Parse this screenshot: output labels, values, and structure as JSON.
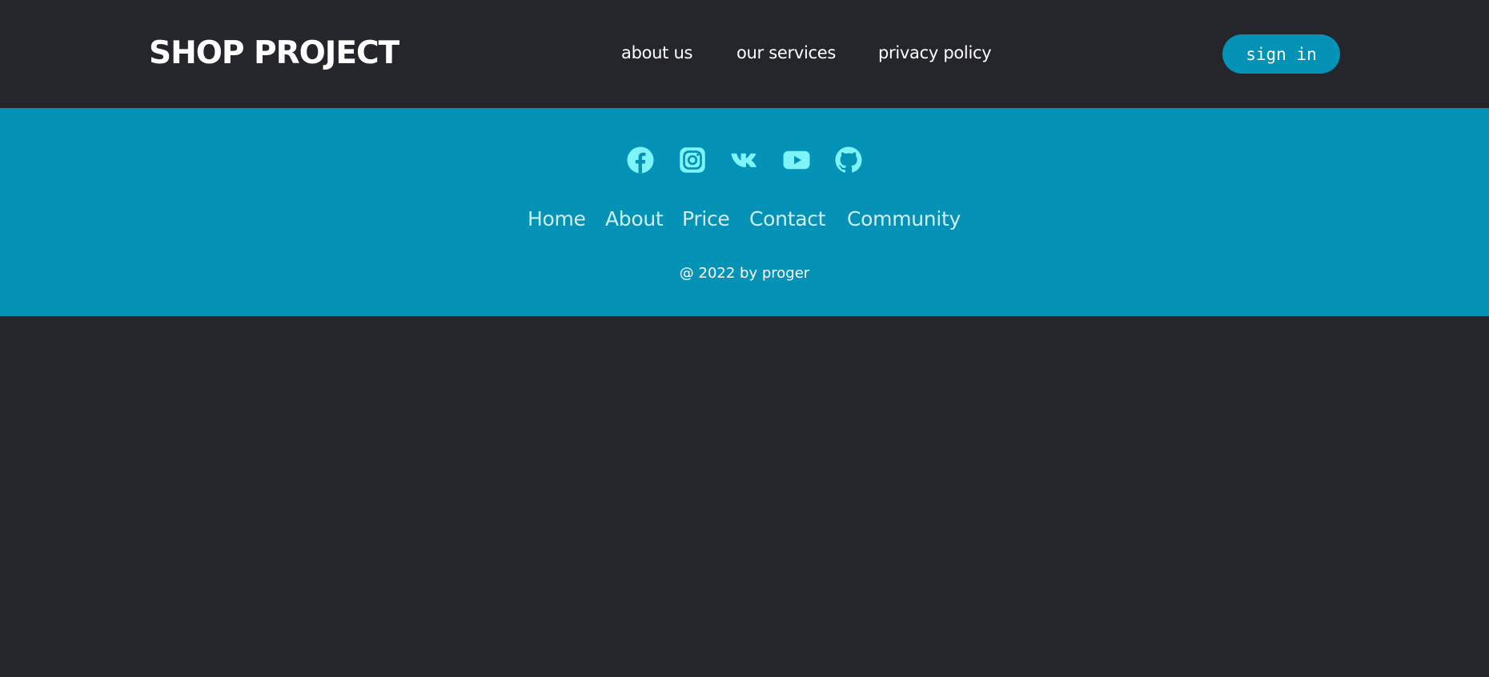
{
  "header": {
    "logo": "SHOP PROJECT",
    "nav": [
      "about us",
      "our services",
      "privacy policy"
    ],
    "signin_label": "sign in"
  },
  "footer": {
    "social_icons": [
      "facebook-icon",
      "instagram-icon",
      "vk-icon",
      "youtube-icon",
      "github-icon"
    ],
    "nav": [
      "Home",
      "About",
      "Price",
      "Contact",
      "Community"
    ],
    "copyright": "@ 2022 by proger"
  },
  "colors": {
    "background": "#25262b",
    "accent": "#0592b7",
    "icon": "#7ef3f8",
    "footer_link": "#cfeef6",
    "text": "#ffffff"
  }
}
